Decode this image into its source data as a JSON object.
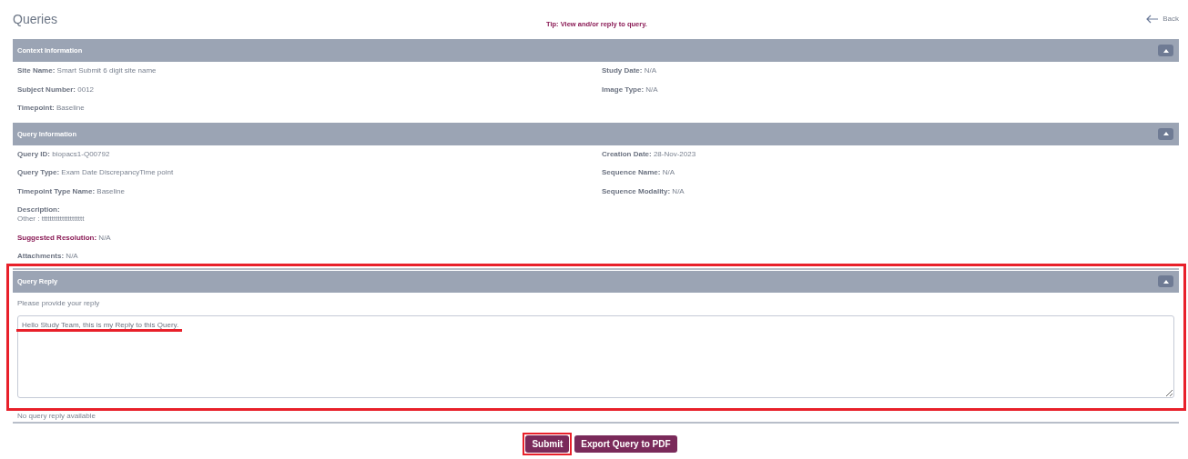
{
  "page": {
    "title": "Queries",
    "tip": "Tip: View and/or reply to query.",
    "back": "Back"
  },
  "sections": [
    {
      "title": "Context Information",
      "expanded": true,
      "left": [
        {
          "label": "Site Name:",
          "value": "Smart Submit 6 digit site name",
          "kind": "inline"
        },
        {
          "label": "Subject Number:",
          "value": "0012",
          "kind": "inline"
        },
        {
          "label": "Timepoint:",
          "value": "Baseline",
          "kind": "inline"
        }
      ],
      "right": [
        {
          "label": "Study Date:",
          "value": "N/A"
        },
        {
          "label": "Image Type:",
          "value": "N/A"
        }
      ]
    },
    {
      "title": "Query Information",
      "expanded": true,
      "left": [
        {
          "label": "Query ID:",
          "value": "biopacs1-Q00792",
          "kind": "inline"
        },
        {
          "label": "Query Type:",
          "value": "Exam Date DiscrepancyTime point",
          "kind": "inline"
        },
        {
          "label": "Timepoint Type Name:",
          "value": "Baseline",
          "kind": "inline"
        },
        {
          "label": "Description:",
          "value": "Other : ttttttttttttttttttttt",
          "kind": "block"
        },
        {
          "label": "Suggested Resolution:",
          "value": "N/A",
          "kind": "highlight"
        },
        {
          "label": "Attachments:",
          "value": "N/A",
          "kind": "inline"
        }
      ],
      "right": [
        {
          "label": "Creation Date:",
          "value": "28-Nov-2023"
        },
        {
          "label": "Sequence Name:",
          "value": "N/A"
        },
        {
          "label": "Sequence Modality:",
          "value": "N/A"
        }
      ]
    }
  ],
  "reply": {
    "title": "Query Reply",
    "expanded": true,
    "prompt": "Please provide your reply",
    "value": "Hello Study Team, this is my Reply to this Query.",
    "empty_note": "No query reply available"
  },
  "buttons": [
    {
      "label": "Submit"
    },
    {
      "label": "Export Query to PDF"
    }
  ]
}
